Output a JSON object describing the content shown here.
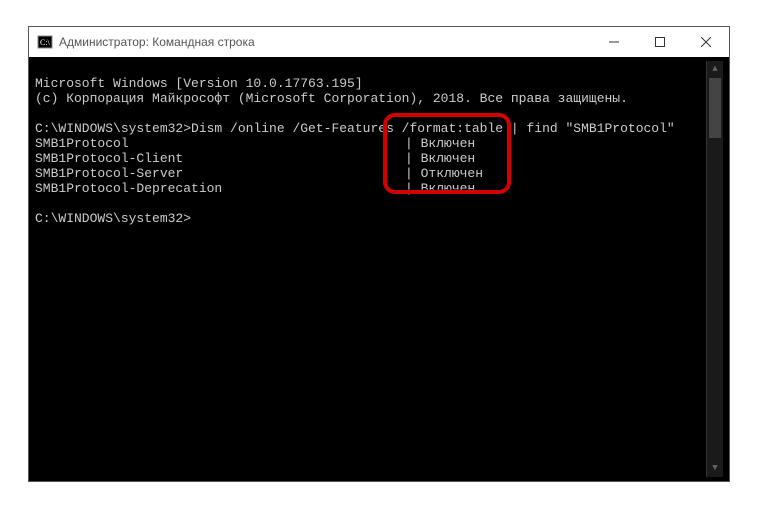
{
  "window": {
    "title": "Администратор: Командная строка"
  },
  "header": {
    "line1": "Microsoft Windows [Version 10.0.17763.195]",
    "line2": "(c) Корпорация Майкрософт (Microsoft Corporation), 2018. Все права защищены."
  },
  "prompt1": "C:\\WINDOWS\\system32>",
  "command": "Dism /online /Get-Features /format:table | find \"SMB1Protocol\"",
  "features": [
    {
      "name": "SMB1Protocol",
      "sep": "| ",
      "state": "Включен"
    },
    {
      "name": "SMB1Protocol-Client",
      "sep": "| ",
      "state": "Включен"
    },
    {
      "name": "SMB1Protocol-Server",
      "sep": "| ",
      "state": "Отключен"
    },
    {
      "name": "SMB1Protocol-Deprecation",
      "sep": "| ",
      "state": "Включен"
    }
  ],
  "prompt2": "C:\\WINDOWS\\system32>"
}
